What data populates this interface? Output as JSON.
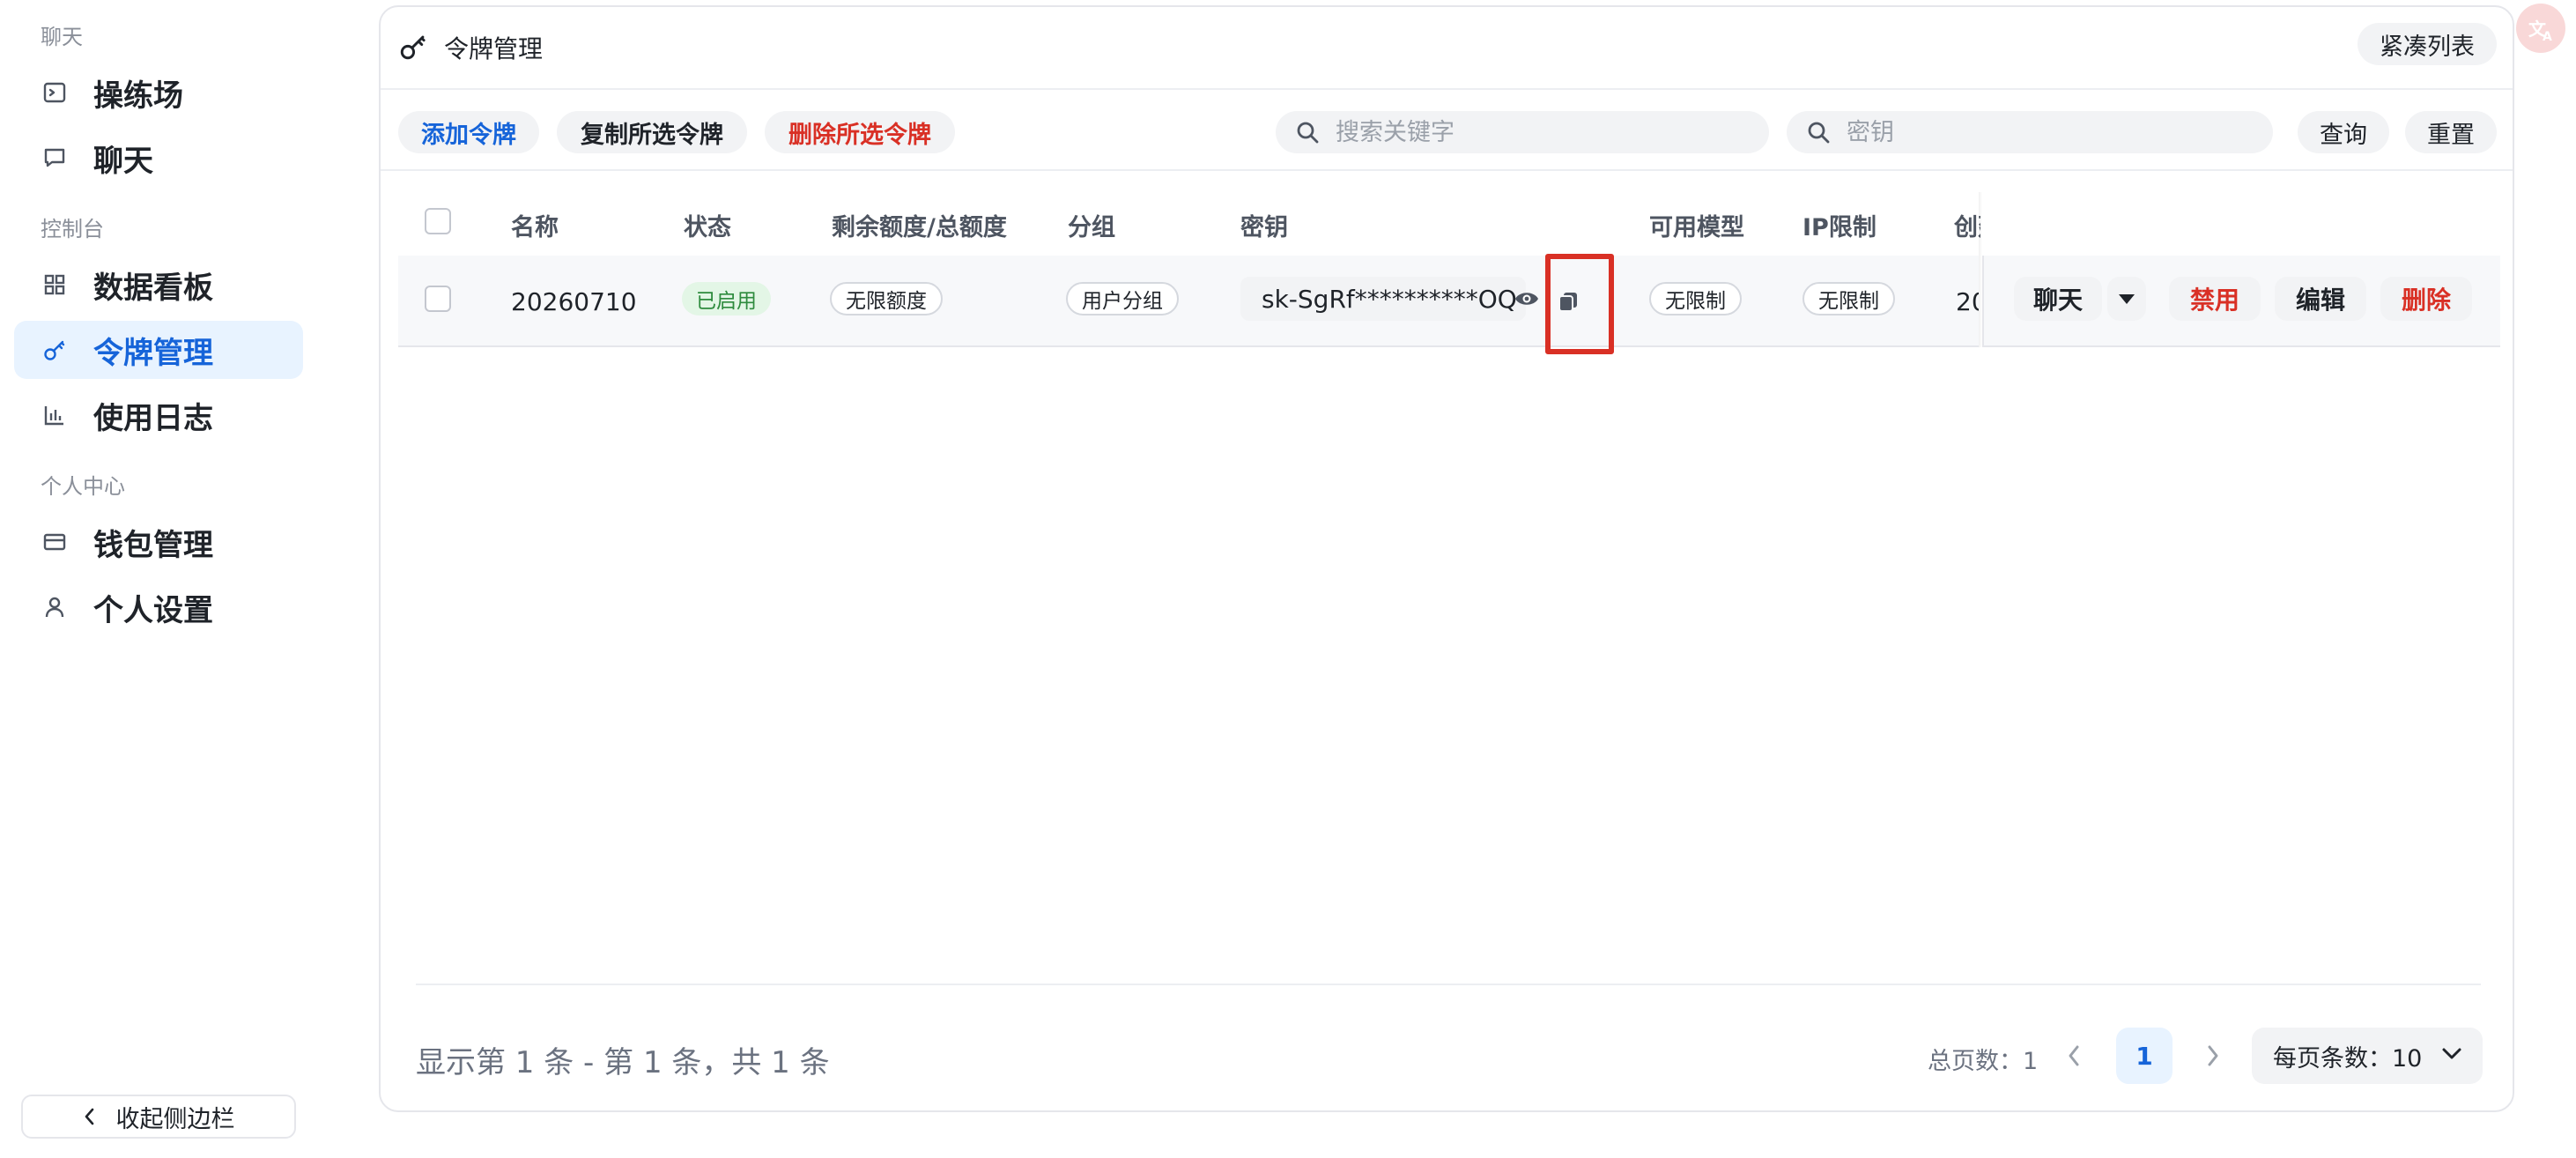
{
  "sidebar": {
    "sections": [
      {
        "title": "聊天"
      },
      {
        "title": "控制台"
      },
      {
        "title": "个人中心"
      }
    ],
    "items": [
      {
        "label": "操练场",
        "icon": "terminal-icon"
      },
      {
        "label": "聊天",
        "icon": "chat-bubble-icon"
      },
      {
        "label": "数据看板",
        "icon": "dashboard-grid-icon"
      },
      {
        "label": "令牌管理",
        "icon": "key-icon",
        "active": true
      },
      {
        "label": "使用日志",
        "icon": "bar-chart-icon"
      },
      {
        "label": "钱包管理",
        "icon": "credit-card-icon"
      },
      {
        "label": "个人设置",
        "icon": "user-icon"
      }
    ],
    "collapse_label": "收起侧边栏"
  },
  "header": {
    "title": "令牌管理",
    "compact_toggle": "紧凑列表"
  },
  "toolbar": {
    "add_label": "添加令牌",
    "copy_selected_label": "复制所选令牌",
    "delete_selected_label": "删除所选令牌",
    "search_keyword_placeholder": "搜索关键字",
    "search_key_placeholder": "密钥",
    "query_label": "查询",
    "reset_label": "重置"
  },
  "table": {
    "columns": [
      "名称",
      "状态",
      "剩余额度/总额度",
      "分组",
      "密钥",
      "可用模型",
      "IP限制",
      "创建"
    ],
    "rows": [
      {
        "name": "20260710",
        "status": "已启用",
        "quota": "无限额度",
        "group": "用户分组",
        "key": "sk-SgRf**********OQ",
        "models": "无限制",
        "ip": "无限制",
        "created": "20",
        "actions": {
          "chat": "聊天",
          "disable": "禁用",
          "edit": "编辑",
          "delete": "删除"
        }
      }
    ]
  },
  "footer": {
    "summary": "显示第 1 条 - 第 1 条，共 1 条",
    "total_pages": "总页数：1",
    "current_page": "1",
    "page_size": "每页条数：10"
  },
  "colors": {
    "accent": "#1664d9",
    "danger": "#d93025",
    "success_bg": "#e3f6e6",
    "success_text": "#2e8b3e",
    "highlight_box": "#d93025"
  }
}
